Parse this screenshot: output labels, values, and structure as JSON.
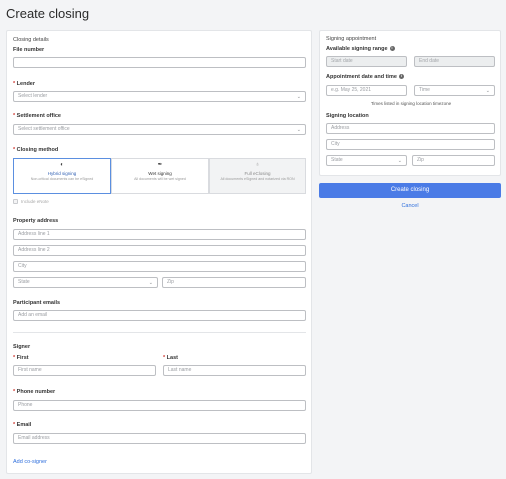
{
  "page": {
    "title": "Create closing"
  },
  "closing_details": {
    "section_title": "Closing details",
    "file_number": {
      "label": "File number",
      "value": ""
    },
    "lender": {
      "label": "Lender",
      "placeholder": "Select lender"
    },
    "settlement_office": {
      "label": "Settlement office",
      "placeholder": "Select settlement office"
    },
    "closing_method": {
      "label": "Closing method",
      "options": [
        {
          "title": "Hybrid signing",
          "desc": "Non-critical documents can be eSigned",
          "icon": "hybrid-icon"
        },
        {
          "title": "Wet signing",
          "desc": "All documents will be wet signed",
          "icon": "pen-icon"
        },
        {
          "title": "Full eClosing",
          "desc": "All documents eSigned and notarized via RON",
          "icon": "bulb-icon"
        }
      ],
      "selected": "Hybrid signing"
    },
    "include_enotes": {
      "label": "Include eNote"
    }
  },
  "property_address": {
    "label": "Property address",
    "line1_placeholder": "Address line 1",
    "line2_placeholder": "Address line 2",
    "city_placeholder": "City",
    "state_placeholder": "State",
    "zip_placeholder": "Zip"
  },
  "participant_emails": {
    "label": "Participant emails",
    "placeholder": "Add an email"
  },
  "signer": {
    "label": "Signer",
    "first_label": "First",
    "first_placeholder": "First name",
    "last_label": "Last",
    "last_placeholder": "Last name",
    "phone_label": "Phone number",
    "phone_placeholder": "Phone",
    "email_label": "Email",
    "email_placeholder": "Email address",
    "add_cosigner": "Add co-signer"
  },
  "signing_appointment": {
    "section_title": "Signing appointment",
    "range_label": "Available signing range",
    "start_placeholder": "Start date",
    "end_placeholder": "End date",
    "datetime_label": "Appointment date and time",
    "date_placeholder": "e.g. May 25, 2021",
    "time_placeholder": "Time",
    "tz_note": "Times listed in signing location timezone",
    "location_label": "Signing location",
    "address_placeholder": "Address",
    "city_placeholder": "City",
    "state_placeholder": "State",
    "zip_placeholder": "Zip"
  },
  "actions": {
    "create": "Create closing",
    "cancel": "Cancel"
  },
  "colors": {
    "accent": "#4a7be6",
    "link": "#2f6fdc",
    "required": "#d0342c"
  },
  "required_marker": "*",
  "info_glyph": "i",
  "chevron_glyph": "⌄"
}
